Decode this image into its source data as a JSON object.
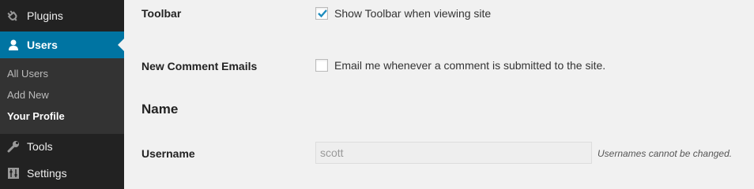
{
  "sidebar": {
    "items": [
      {
        "label": "Plugins",
        "icon": "plugins-icon"
      },
      {
        "label": "Users",
        "icon": "users-icon",
        "current": true
      },
      {
        "label": "Tools",
        "icon": "tools-icon"
      },
      {
        "label": "Settings",
        "icon": "settings-icon"
      }
    ],
    "submenu": [
      {
        "label": "All Users"
      },
      {
        "label": "Add New"
      },
      {
        "label": "Your Profile",
        "active": true
      }
    ],
    "colors": {
      "background": "#222222",
      "current": "#0074a2",
      "submenu_background": "#333333"
    }
  },
  "form": {
    "toolbar": {
      "label": "Toolbar",
      "checkbox_text": "Show Toolbar when viewing site",
      "checked": true
    },
    "comment_emails": {
      "label": "New Comment Emails",
      "checkbox_text": "Email me whenever a comment is submitted to the site.",
      "checked": false
    },
    "name_section": {
      "title": "Name"
    },
    "username": {
      "label": "Username",
      "value": "scott",
      "description": "Usernames cannot be changed."
    }
  },
  "colors": {
    "page_background": "#f1f1f1",
    "checkmark": "#1e8cbe"
  }
}
